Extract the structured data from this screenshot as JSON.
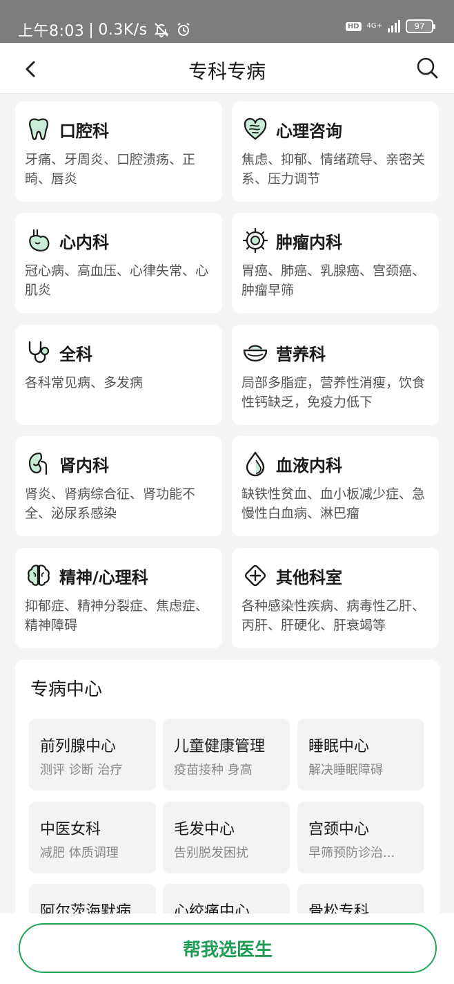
{
  "status_bar": {
    "time": "上午8:03",
    "speed": "0.3K/s",
    "hd": "HD",
    "network": "4G+",
    "battery": "97"
  },
  "header": {
    "title": "专科专病"
  },
  "departments": [
    {
      "name": "口腔科",
      "desc": "牙痛、牙周炎、口腔溃疡、正畸、唇炎",
      "icon": "tooth-icon"
    },
    {
      "name": "心理咨询",
      "desc": "焦虑、抑郁、情绪疏导、亲密关系、压力调节",
      "icon": "heart-mind-icon"
    },
    {
      "name": "心内科",
      "desc": "冠心病、高血压、心律失常、心肌炎",
      "icon": "heart-organ-icon"
    },
    {
      "name": "肿瘤内科",
      "desc": "胃癌、肺癌、乳腺癌、宫颈癌、肿瘤早筛",
      "icon": "tumor-cell-icon"
    },
    {
      "name": "全科",
      "desc": "各科常见病、多发病",
      "icon": "stethoscope-icon"
    },
    {
      "name": "营养科",
      "desc": "局部多脂症，营养性消瘦，饮食性钙缺乏，免疫力低下",
      "icon": "bowl-icon"
    },
    {
      "name": "肾内科",
      "desc": "肾炎、肾病综合征、肾功能不全、泌尿系感染",
      "icon": "kidney-icon"
    },
    {
      "name": "血液内科",
      "desc": "缺铁性贫血、血小板减少症、急慢性白血病、淋巴瘤",
      "icon": "blood-drop-icon"
    },
    {
      "name": "精神/心理科",
      "desc": "抑郁症、精神分裂症、焦虑症、精神障碍",
      "icon": "brain-icon"
    },
    {
      "name": "其他科室",
      "desc": "各种感染性疾病、病毒性乙肝、丙肝、肝硬化、肝衰竭等",
      "icon": "plus-diamond-icon"
    }
  ],
  "center": {
    "title": "专病中心",
    "items": [
      {
        "title": "前列腺中心",
        "sub": "测评 诊断 治疗"
      },
      {
        "title": "儿童健康管理",
        "sub": "疫苗接种 身高"
      },
      {
        "title": "睡眠中心",
        "sub": "解决睡眠障碍"
      },
      {
        "title": "中医女科",
        "sub": "减肥 体质调理"
      },
      {
        "title": "毛发中心",
        "sub": "告别脱发困扰"
      },
      {
        "title": "宫颈中心",
        "sub": "早筛预防诊治..."
      },
      {
        "title": "阿尔茨海默病",
        "sub": ""
      },
      {
        "title": "心绞痛中心",
        "sub": ""
      },
      {
        "title": "骨松专科",
        "sub": ""
      }
    ]
  },
  "cta": {
    "label": "帮我选医生"
  },
  "colors": {
    "brand_green": "#1f9d55",
    "icon_light_green": "#c9ecd6"
  }
}
